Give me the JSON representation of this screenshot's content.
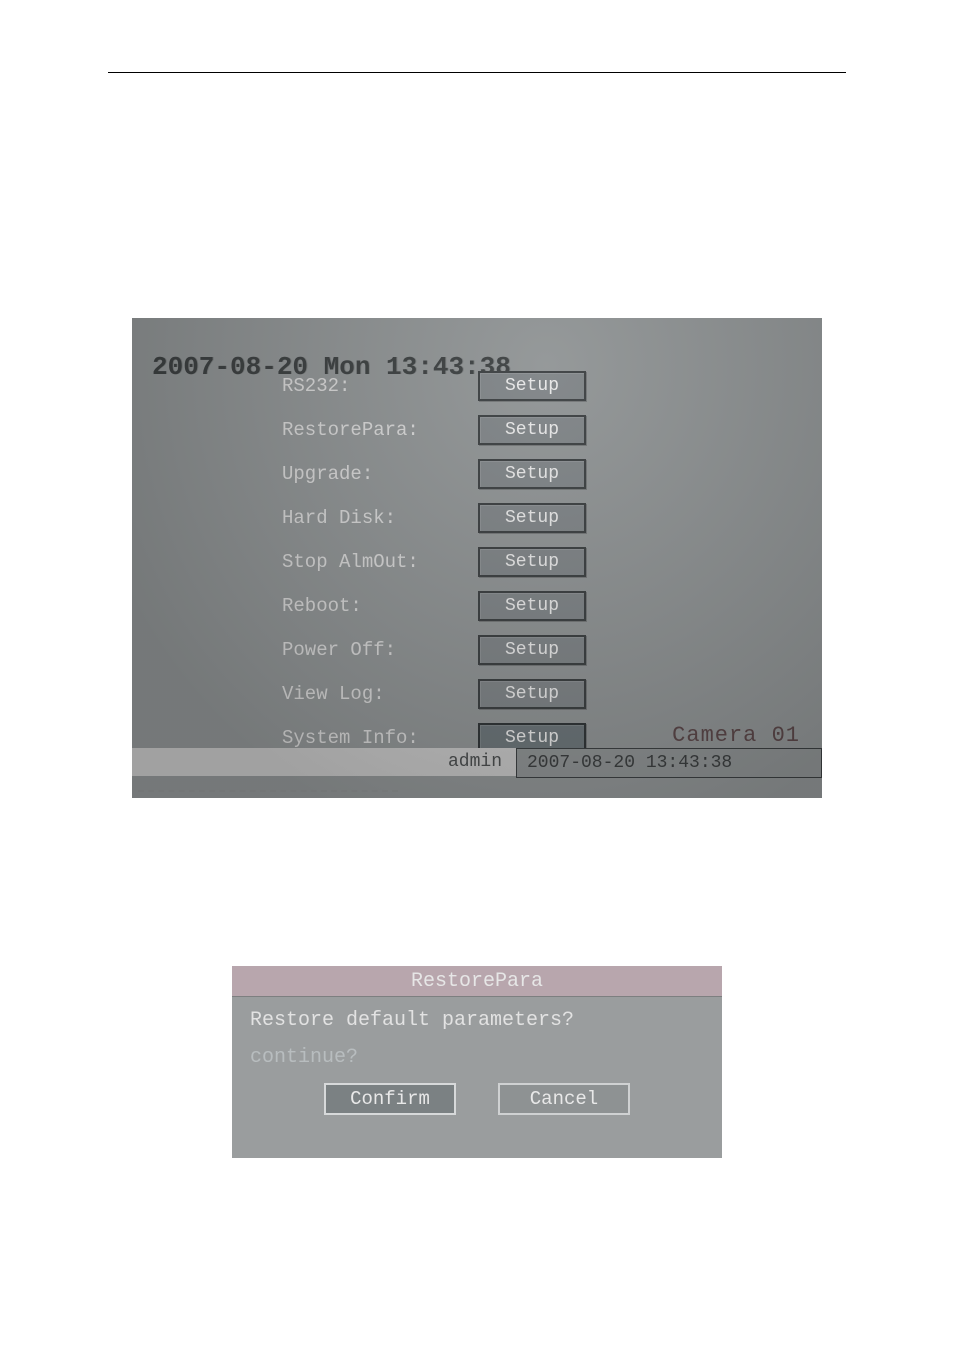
{
  "screenshot1": {
    "timestamp_bg": "2007-08-20 Mon 13:43:38",
    "rows": [
      {
        "label": "RS232:",
        "button": "Setup"
      },
      {
        "label": "RestorePara:",
        "button": "Setup"
      },
      {
        "label": "Upgrade:",
        "button": "Setup"
      },
      {
        "label": "Hard Disk:",
        "button": "Setup"
      },
      {
        "label": "Stop AlmOut:",
        "button": "Setup"
      },
      {
        "label": "Reboot:",
        "button": "Setup"
      },
      {
        "label": "Power Off:",
        "button": "Setup"
      },
      {
        "label": "View Log:",
        "button": "Setup"
      },
      {
        "label": "System Info:",
        "button": "Setup"
      }
    ],
    "camera_ghost": "Camera 01",
    "status_user": "admin",
    "status_time": "2007-08-20 13:43:38"
  },
  "screenshot2": {
    "title": "RestorePara",
    "line1": "Restore default parameters?",
    "line2": "continue?",
    "confirm": "Confirm",
    "cancel": "Cancel"
  }
}
